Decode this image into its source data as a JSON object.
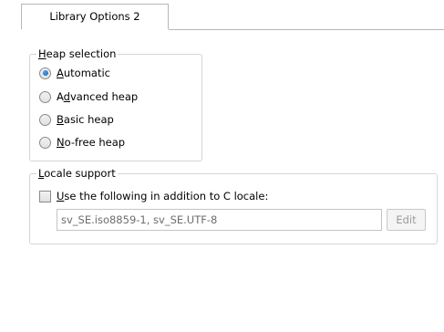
{
  "tab": {
    "label": "Library Options 2"
  },
  "heap": {
    "legend_mnemonic": "H",
    "legend_rest": "eap selection",
    "options": [
      {
        "pre": "",
        "mnemonic": "A",
        "post": "utomatic",
        "checked": true
      },
      {
        "pre": "A",
        "mnemonic": "d",
        "post": "vanced heap",
        "checked": false
      },
      {
        "pre": "",
        "mnemonic": "B",
        "post": "asic heap",
        "checked": false
      },
      {
        "pre": "",
        "mnemonic": "N",
        "post": "o-free heap",
        "checked": false
      }
    ]
  },
  "locale": {
    "legend_mnemonic": "L",
    "legend_rest": "ocale support",
    "checkbox_mnemonic": "U",
    "checkbox_rest": "se the following in addition to C locale:",
    "checkbox_checked": false,
    "input_value": "sv_SE.iso8859-1, sv_SE.UTF-8",
    "edit_label": "Edit"
  }
}
